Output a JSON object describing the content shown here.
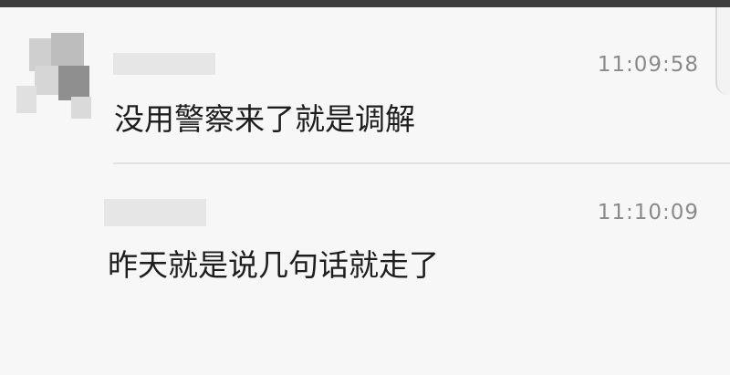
{
  "messages": [
    {
      "time": "11:09:58",
      "text": "没用警察来了就是调解"
    },
    {
      "time": "11:10:09",
      "text": "昨天就是说几句话就走了"
    }
  ]
}
